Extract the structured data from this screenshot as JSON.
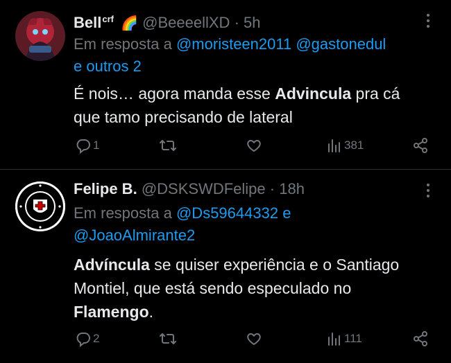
{
  "tweets": [
    {
      "name": "Bell",
      "name_sup": "crf",
      "name_emoji": "🌈",
      "handle": "@BeeeellXD",
      "dot": "·",
      "time": "5h",
      "reply_prefix": "Em resposta a",
      "reply_mentions": [
        "@moristeen2011",
        "@gastonedul"
      ],
      "reply_suffix": "e outros 2",
      "body_line1_pre": "É nois… agora manda esse ",
      "body_line1_bold": "Advincula",
      "body_line1_post": " pra cá",
      "body_line2": "que tamo precisando de lateral",
      "replies": "1",
      "retweets": "",
      "likes": "",
      "views": "381"
    },
    {
      "name": "Felipe B.",
      "handle": "@DSKSWDFelipe",
      "dot": "·",
      "time": "18h",
      "reply_prefix": "Em resposta a",
      "reply_mentions": [
        "@Ds59644332",
        "@JoaoAlmirante2"
      ],
      "reply_and": "e",
      "body_line1_bold": "Advíncula",
      "body_line1_post": " se quiser experiência e o Santiago",
      "body_line2": "Montiel, que está sendo especulado no",
      "body_line3_bold": "Flamengo",
      "body_line3_post": ".",
      "replies": "2",
      "retweets": "",
      "likes": "",
      "views": "111"
    }
  ],
  "colors": {
    "background": "#000000",
    "text": "#e7e9ea",
    "muted": "#71767b",
    "link": "#1d9bf0",
    "divider": "#2f3336"
  }
}
